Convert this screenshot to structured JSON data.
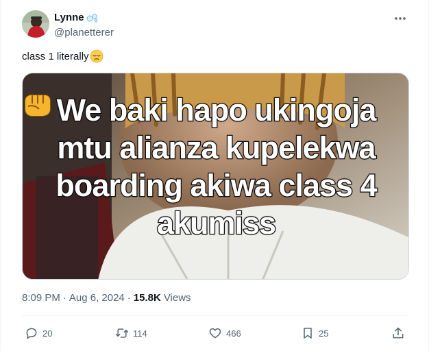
{
  "tweet": {
    "display_name": "Lynne",
    "handle": "@planetterer",
    "text": "class 1 literally",
    "text_emoji": "pensive-face",
    "name_emoji": "bubbles",
    "media": {
      "caption_lines": [
        "We baki hapo ukingoja",
        "mtu alianza kupelekwa",
        "boarding akiwa class 4",
        "akumiss"
      ],
      "caption_emoji": "oncoming-fist"
    },
    "time": "8:09 PM",
    "separator": "·",
    "date": "Aug 6, 2024",
    "views_count": "15.8K",
    "views_label": "Views"
  },
  "actions": {
    "replies": "20",
    "reposts": "114",
    "likes": "466",
    "bookmarks": "25"
  },
  "icons": {
    "more": "more-dots-icon",
    "reply": "reply-icon",
    "repost": "repost-icon",
    "like": "heart-icon",
    "bookmark": "bookmark-icon",
    "share": "share-icon"
  },
  "colors": {
    "text_primary": "#0f1419",
    "text_secondary": "#536471",
    "divider": "#eff3f4"
  }
}
